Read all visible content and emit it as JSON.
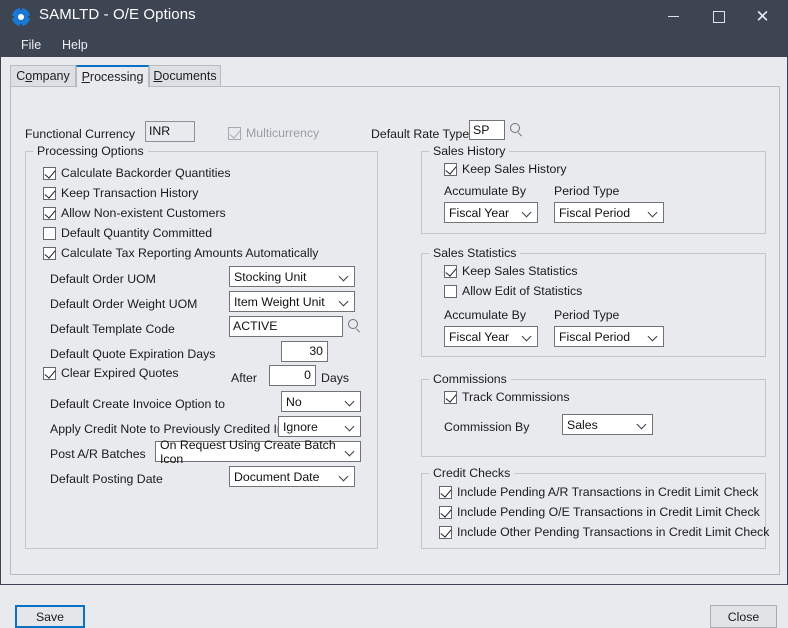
{
  "window": {
    "title": "SAMLTD - O/E Options",
    "app_icon": "gear-icon",
    "minimize": "minimize-icon",
    "maximize": "maximize-icon",
    "close": "close-icon"
  },
  "menubar": {
    "items": [
      {
        "label": "File",
        "accel": "F"
      },
      {
        "label": "Help",
        "accel": "H"
      }
    ]
  },
  "tabs": [
    {
      "label": "Company",
      "active": false
    },
    {
      "label": "Processing",
      "active": true
    },
    {
      "label": "Documents",
      "active": false
    }
  ],
  "header": {
    "functional_currency_label": "Functional Currency",
    "functional_currency_value": "INR",
    "multicurrency_label": "Multicurrency",
    "multicurrency_checked": true,
    "multicurrency_enabled": false,
    "default_rate_type_label": "Default Rate Type",
    "default_rate_type_value": "SP",
    "default_rate_type_finder": "magnifier-icon"
  },
  "processing_options": {
    "legend": "Processing Options",
    "checkboxes": [
      {
        "label": "Calculate Backorder Quantities",
        "checked": true
      },
      {
        "label": "Keep Transaction History",
        "checked": true
      },
      {
        "label": "Allow Non-existent Customers",
        "checked": true
      },
      {
        "label": "Default Quantity Committed",
        "checked": false
      },
      {
        "label": "Calculate Tax Reporting Amounts Automatically",
        "checked": true
      }
    ],
    "default_order_uom_label": "Default Order UOM",
    "default_order_uom_value": "Stocking Unit",
    "default_order_weight_uom_label": "Default Order Weight UOM",
    "default_order_weight_uom_value": "Item Weight Unit",
    "default_template_code_label": "Default Template Code",
    "default_template_code_value": "ACTIVE",
    "default_template_code_finder": "magnifier-icon",
    "default_quote_expiration_days_label": "Default Quote Expiration Days",
    "default_quote_expiration_days_value": "30",
    "clear_expired_quotes_label": "Clear Expired Quotes",
    "clear_expired_quotes_checked": true,
    "after_label": "After",
    "after_value": "0",
    "days_label": "Days",
    "default_create_invoice_label": "Default Create Invoice Option to",
    "default_create_invoice_value": "No",
    "apply_credit_note_label": "Apply Credit Note to Previously Credited Invoice",
    "apply_credit_note_value": "Ignore",
    "post_ar_batches_label": "Post A/R Batches",
    "post_ar_batches_value": "On Request Using Create Batch Icon",
    "default_posting_date_label": "Default Posting Date",
    "default_posting_date_value": "Document Date"
  },
  "sales_history": {
    "legend": "Sales History",
    "keep_label": "Keep Sales History",
    "keep_checked": true,
    "accumulate_by_label": "Accumulate By",
    "accumulate_by_value": "Fiscal Year",
    "period_type_label": "Period Type",
    "period_type_value": "Fiscal Period"
  },
  "sales_statistics": {
    "legend": "Sales Statistics",
    "keep_label": "Keep Sales Statistics",
    "keep_checked": true,
    "allow_edit_label": "Allow Edit of Statistics",
    "allow_edit_checked": false,
    "accumulate_by_label": "Accumulate By",
    "accumulate_by_value": "Fiscal Year",
    "period_type_label": "Period Type",
    "period_type_value": "Fiscal Period"
  },
  "commissions": {
    "legend": "Commissions",
    "track_label": "Track Commissions",
    "track_checked": true,
    "commission_by_label": "Commission By",
    "commission_by_value": "Sales"
  },
  "credit_checks": {
    "legend": "Credit Checks",
    "checkboxes": [
      {
        "label": "Include Pending A/R Transactions in Credit Limit Check",
        "checked": true
      },
      {
        "label": "Include Pending O/E Transactions in Credit Limit Check",
        "checked": true
      },
      {
        "label": "Include Other Pending Transactions in Credit Limit Check",
        "checked": true
      }
    ]
  },
  "footer": {
    "save_label": "Save",
    "close_label": "Close"
  },
  "colors": {
    "titlebar": "#3d4452",
    "accent": "#0a72c4",
    "face": "#e8eaed",
    "field": "#ffffff",
    "border": "#6f7479"
  }
}
